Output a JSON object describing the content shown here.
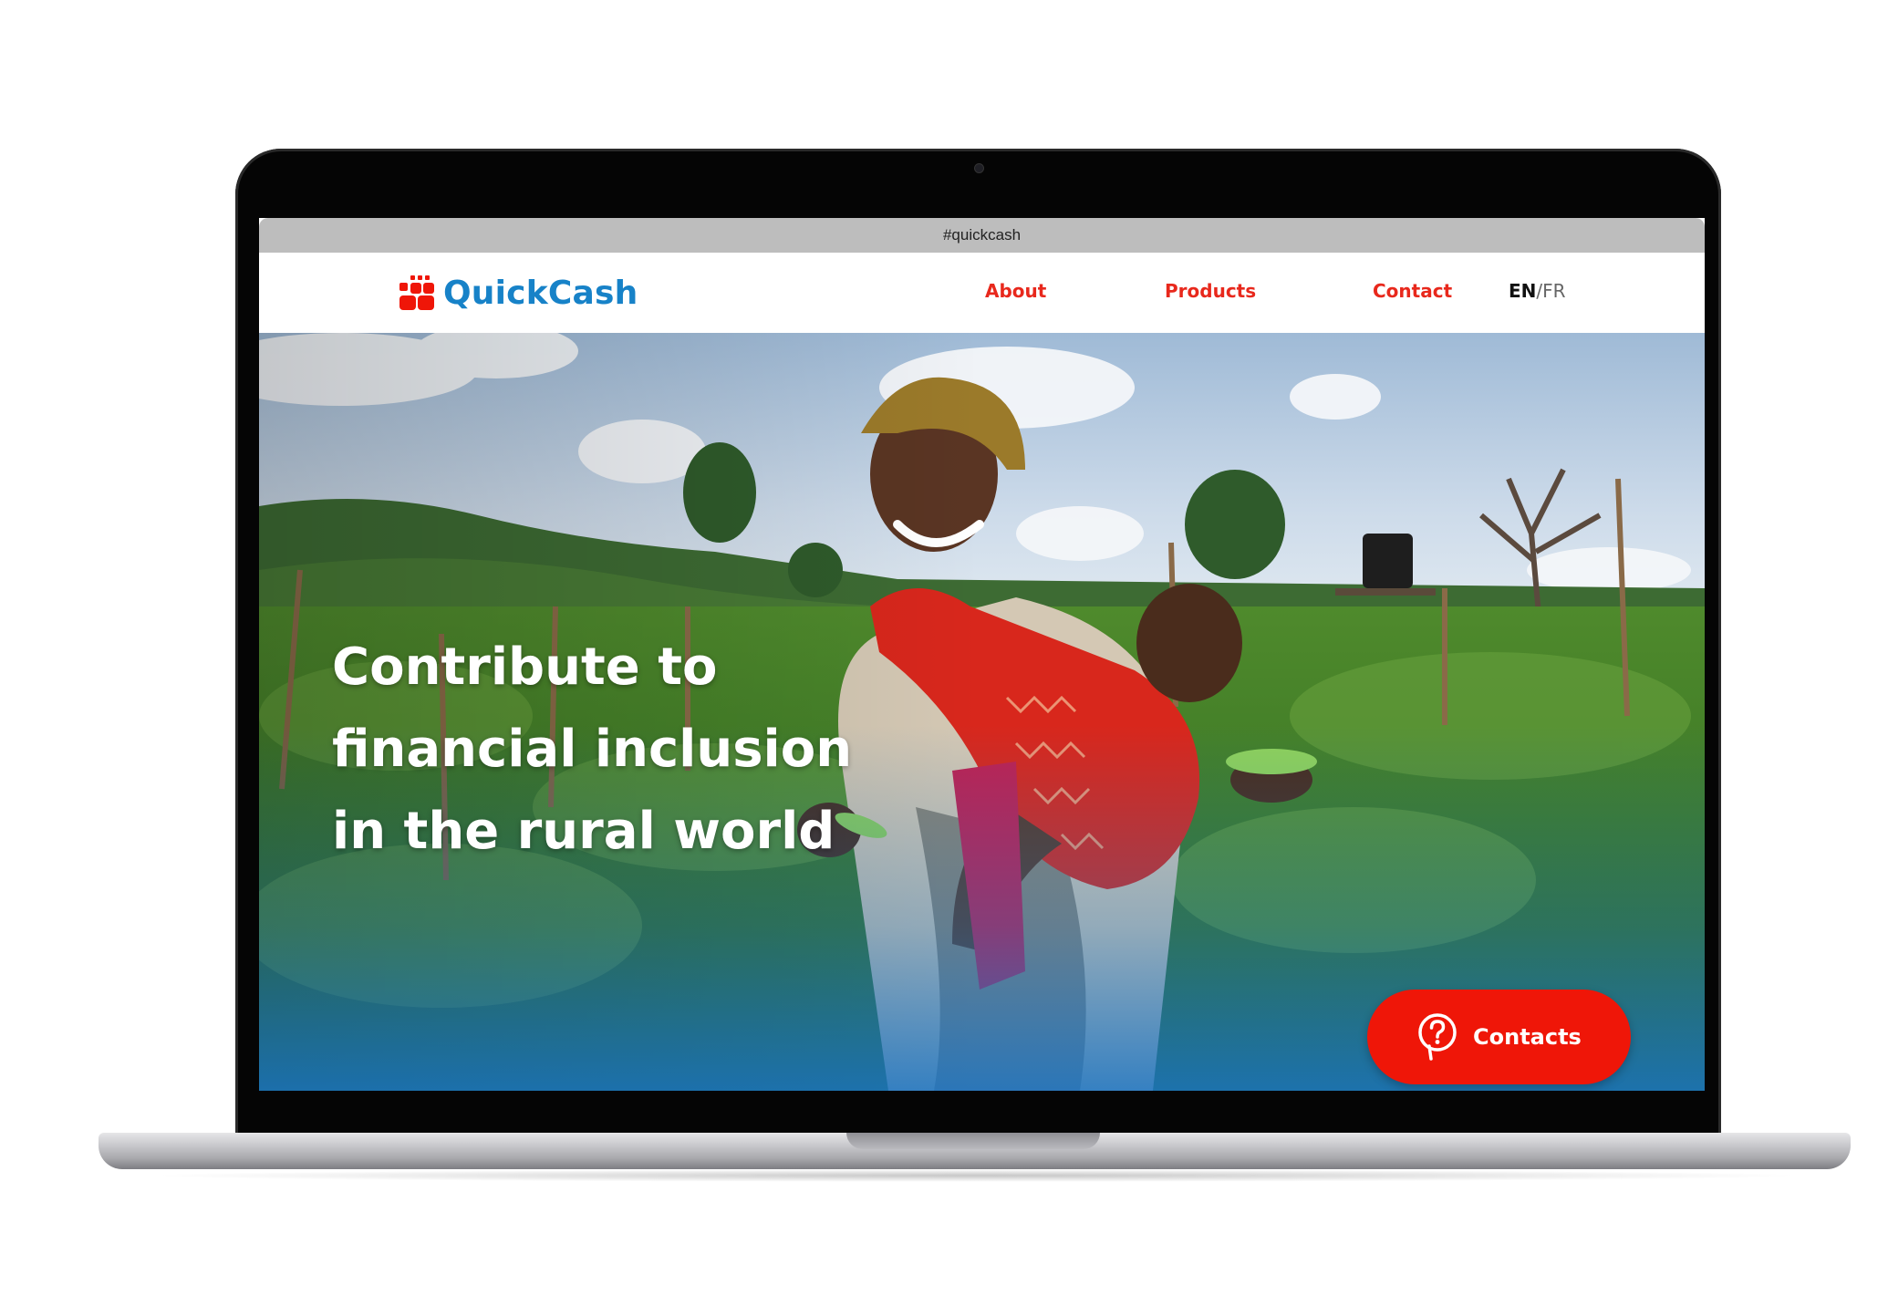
{
  "browser": {
    "url": "#quickcash"
  },
  "header": {
    "logo_text": "QuickCash",
    "nav": [
      {
        "label": "About"
      },
      {
        "label": "Products"
      },
      {
        "label": "Contact"
      }
    ],
    "language": {
      "active": "EN",
      "separator": "/",
      "other": "FR"
    }
  },
  "hero": {
    "headline": [
      "Contribute to",
      "financial inclusion",
      "in the rural world"
    ],
    "contacts_button": {
      "label": "Contacts",
      "icon": "question-bubble-icon"
    }
  },
  "colors": {
    "brand_blue": "#1782c8",
    "accent_red": "#e8281c",
    "button_red": "#ef1608"
  }
}
